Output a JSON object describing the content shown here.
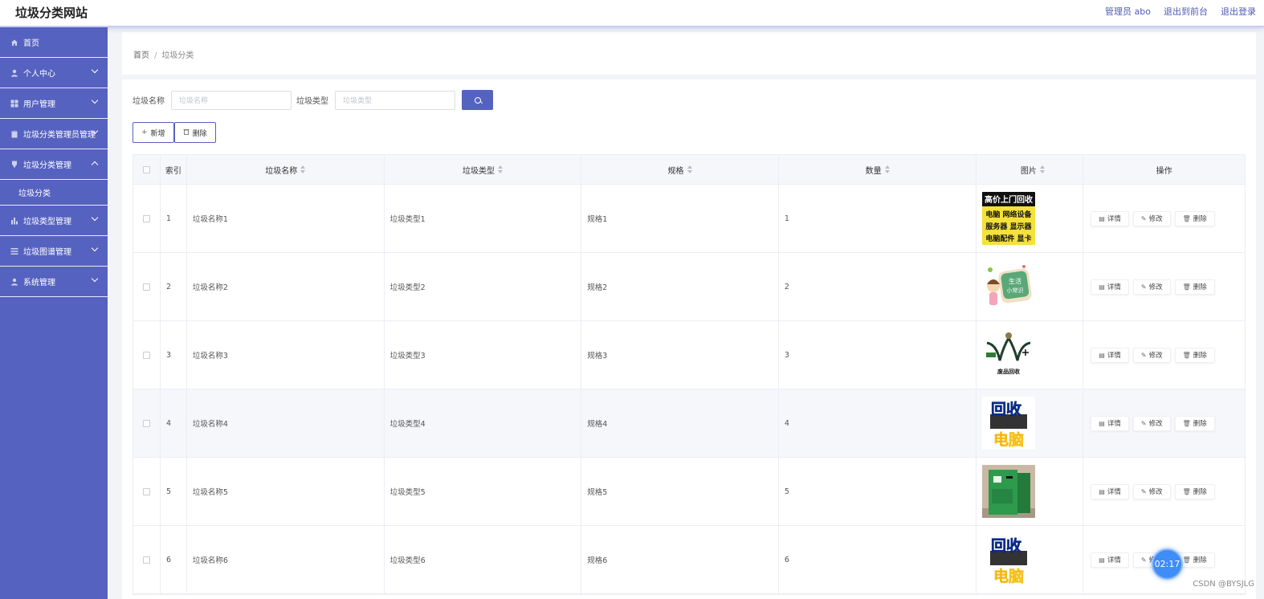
{
  "header": {
    "site_title": "垃圾分类网站",
    "admin_label": "管理员 abo",
    "to_front_label": "退出到前台",
    "logout_label": "退出登录"
  },
  "sidebar": {
    "items": [
      {
        "label": "首页",
        "icon": "home-icon",
        "has_arrow": false
      },
      {
        "label": "个人中心",
        "icon": "user-icon",
        "has_arrow": true
      },
      {
        "label": "用户管理",
        "icon": "grid-icon",
        "has_arrow": true
      },
      {
        "label": "垃圾分类管理员管理",
        "icon": "clipboard-icon",
        "has_arrow": true
      },
      {
        "label": "垃圾分类管理",
        "icon": "pin-icon",
        "has_arrow": true,
        "expanded": true
      },
      {
        "label": "垃圾分类",
        "sub": true
      },
      {
        "label": "垃圾类型管理",
        "icon": "bar-chart-icon",
        "has_arrow": true
      },
      {
        "label": "垃圾图谱管理",
        "icon": "list-icon",
        "has_arrow": true
      },
      {
        "label": "系统管理",
        "icon": "user-icon",
        "has_arrow": true
      }
    ]
  },
  "breadcrumb": {
    "home": "首页",
    "separator": "/",
    "current": "垃圾分类"
  },
  "search": {
    "name_label": "垃圾名称",
    "name_placeholder": "垃圾名称",
    "type_label": "垃圾类型",
    "type_placeholder": "垃圾类型"
  },
  "actions": {
    "add_label": "新增",
    "delete_label": "删除"
  },
  "table": {
    "headers": {
      "index": "索引",
      "name": "垃圾名称",
      "type": "垃圾类型",
      "spec": "规格",
      "quantity": "数量",
      "image": "图片",
      "operation": "操作"
    },
    "row_buttons": {
      "detail": "详情",
      "edit": "修改",
      "delete": "删除"
    },
    "rows": [
      {
        "index": "1",
        "name": "垃圾名称1",
        "type": "垃圾类型1",
        "spec": "规格1",
        "quantity": "1",
        "image_text": [
          "高价上门回收",
          "电脑 网络设备",
          "服务器 显示器",
          "电脑配件 显卡"
        ]
      },
      {
        "index": "2",
        "name": "垃圾名称2",
        "type": "垃圾类型2",
        "spec": "规格2",
        "quantity": "2",
        "image_text": [
          "生活",
          "小常识"
        ]
      },
      {
        "index": "3",
        "name": "垃圾名称3",
        "type": "垃圾类型3",
        "spec": "规格3",
        "quantity": "3",
        "image_text": [
          "废品回收"
        ]
      },
      {
        "index": "4",
        "name": "垃圾名称4",
        "type": "垃圾类型4",
        "spec": "规格4",
        "quantity": "4",
        "image_text": [
          "回收",
          "电脑"
        ]
      },
      {
        "index": "5",
        "name": "垃圾名称5",
        "type": "垃圾类型5",
        "spec": "规格5",
        "quantity": "5",
        "image_text": []
      },
      {
        "index": "6",
        "name": "垃圾名称6",
        "type": "垃圾类型6",
        "spec": "规格6",
        "quantity": "6",
        "image_text": [
          "回收",
          "电脑"
        ]
      }
    ]
  },
  "overlay": {
    "timer": "02:17",
    "watermark": "CSDN @BYSJLG"
  },
  "colors": {
    "sidebar_bg": "#5662c0",
    "accent": "#5563c0",
    "timer_bg": "#3f8df6"
  }
}
